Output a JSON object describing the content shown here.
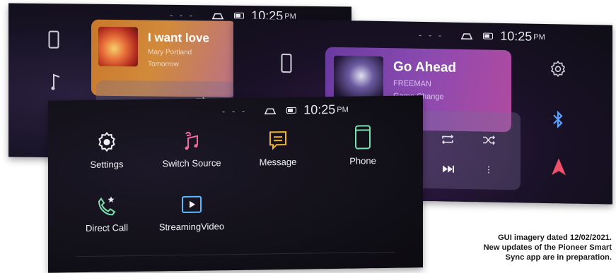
{
  "status": {
    "time": "10:25",
    "ampm": "PM"
  },
  "screen_back_left": {
    "now_playing": {
      "title": "I want love",
      "artist": "Mary Portland",
      "album": "Tomorrow"
    }
  },
  "screen_back_right": {
    "now_playing": {
      "title": "Go Ahead",
      "artist": "FREEMAN",
      "album": "Game Change"
    }
  },
  "screen_front": {
    "apps": [
      {
        "label": "Settings",
        "icon": "gear-icon"
      },
      {
        "label": "Switch Source",
        "icon": "music-note-icon"
      },
      {
        "label": "Message",
        "icon": "message-icon"
      },
      {
        "label": "Phone",
        "icon": "phone-icon"
      },
      {
        "label": "Direct Call",
        "icon": "direct-call-icon"
      },
      {
        "label": "StreamingVideo",
        "icon": "play-icon"
      }
    ]
  },
  "caption": {
    "line1": "GUI imagery dated 12/02/2021.",
    "line2": "New updates of the Pioneer Smart",
    "line3": "Sync app are in preparation."
  },
  "colors": {
    "accent_music": "#f06aa0",
    "accent_message": "#f0b030",
    "accent_phone": "#7ae0b0",
    "accent_nav": "#f0506a",
    "accent_bt": "#5aa0ff"
  }
}
